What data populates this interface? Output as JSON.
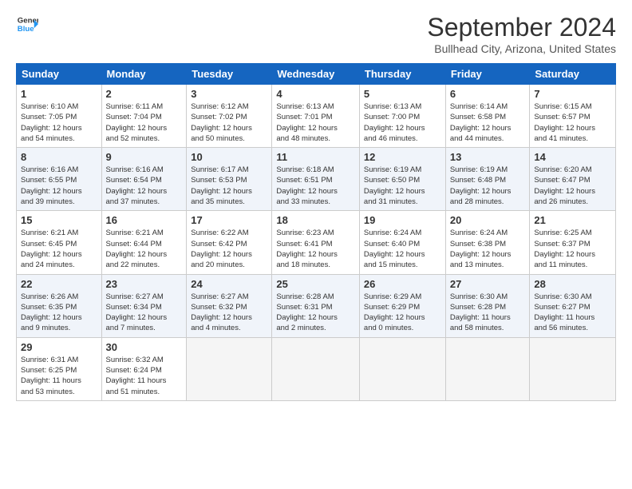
{
  "header": {
    "logo_line1": "General",
    "logo_line2": "Blue",
    "month_title": "September 2024",
    "location": "Bullhead City, Arizona, United States"
  },
  "weekdays": [
    "Sunday",
    "Monday",
    "Tuesday",
    "Wednesday",
    "Thursday",
    "Friday",
    "Saturday"
  ],
  "weeks": [
    [
      {
        "day": "1",
        "info": "Sunrise: 6:10 AM\nSunset: 7:05 PM\nDaylight: 12 hours\nand 54 minutes."
      },
      {
        "day": "2",
        "info": "Sunrise: 6:11 AM\nSunset: 7:04 PM\nDaylight: 12 hours\nand 52 minutes."
      },
      {
        "day": "3",
        "info": "Sunrise: 6:12 AM\nSunset: 7:02 PM\nDaylight: 12 hours\nand 50 minutes."
      },
      {
        "day": "4",
        "info": "Sunrise: 6:13 AM\nSunset: 7:01 PM\nDaylight: 12 hours\nand 48 minutes."
      },
      {
        "day": "5",
        "info": "Sunrise: 6:13 AM\nSunset: 7:00 PM\nDaylight: 12 hours\nand 46 minutes."
      },
      {
        "day": "6",
        "info": "Sunrise: 6:14 AM\nSunset: 6:58 PM\nDaylight: 12 hours\nand 44 minutes."
      },
      {
        "day": "7",
        "info": "Sunrise: 6:15 AM\nSunset: 6:57 PM\nDaylight: 12 hours\nand 41 minutes."
      }
    ],
    [
      {
        "day": "8",
        "info": "Sunrise: 6:16 AM\nSunset: 6:55 PM\nDaylight: 12 hours\nand 39 minutes."
      },
      {
        "day": "9",
        "info": "Sunrise: 6:16 AM\nSunset: 6:54 PM\nDaylight: 12 hours\nand 37 minutes."
      },
      {
        "day": "10",
        "info": "Sunrise: 6:17 AM\nSunset: 6:53 PM\nDaylight: 12 hours\nand 35 minutes."
      },
      {
        "day": "11",
        "info": "Sunrise: 6:18 AM\nSunset: 6:51 PM\nDaylight: 12 hours\nand 33 minutes."
      },
      {
        "day": "12",
        "info": "Sunrise: 6:19 AM\nSunset: 6:50 PM\nDaylight: 12 hours\nand 31 minutes."
      },
      {
        "day": "13",
        "info": "Sunrise: 6:19 AM\nSunset: 6:48 PM\nDaylight: 12 hours\nand 28 minutes."
      },
      {
        "day": "14",
        "info": "Sunrise: 6:20 AM\nSunset: 6:47 PM\nDaylight: 12 hours\nand 26 minutes."
      }
    ],
    [
      {
        "day": "15",
        "info": "Sunrise: 6:21 AM\nSunset: 6:45 PM\nDaylight: 12 hours\nand 24 minutes."
      },
      {
        "day": "16",
        "info": "Sunrise: 6:21 AM\nSunset: 6:44 PM\nDaylight: 12 hours\nand 22 minutes."
      },
      {
        "day": "17",
        "info": "Sunrise: 6:22 AM\nSunset: 6:42 PM\nDaylight: 12 hours\nand 20 minutes."
      },
      {
        "day": "18",
        "info": "Sunrise: 6:23 AM\nSunset: 6:41 PM\nDaylight: 12 hours\nand 18 minutes."
      },
      {
        "day": "19",
        "info": "Sunrise: 6:24 AM\nSunset: 6:40 PM\nDaylight: 12 hours\nand 15 minutes."
      },
      {
        "day": "20",
        "info": "Sunrise: 6:24 AM\nSunset: 6:38 PM\nDaylight: 12 hours\nand 13 minutes."
      },
      {
        "day": "21",
        "info": "Sunrise: 6:25 AM\nSunset: 6:37 PM\nDaylight: 12 hours\nand 11 minutes."
      }
    ],
    [
      {
        "day": "22",
        "info": "Sunrise: 6:26 AM\nSunset: 6:35 PM\nDaylight: 12 hours\nand 9 minutes."
      },
      {
        "day": "23",
        "info": "Sunrise: 6:27 AM\nSunset: 6:34 PM\nDaylight: 12 hours\nand 7 minutes."
      },
      {
        "day": "24",
        "info": "Sunrise: 6:27 AM\nSunset: 6:32 PM\nDaylight: 12 hours\nand 4 minutes."
      },
      {
        "day": "25",
        "info": "Sunrise: 6:28 AM\nSunset: 6:31 PM\nDaylight: 12 hours\nand 2 minutes."
      },
      {
        "day": "26",
        "info": "Sunrise: 6:29 AM\nSunset: 6:29 PM\nDaylight: 12 hours\nand 0 minutes."
      },
      {
        "day": "27",
        "info": "Sunrise: 6:30 AM\nSunset: 6:28 PM\nDaylight: 11 hours\nand 58 minutes."
      },
      {
        "day": "28",
        "info": "Sunrise: 6:30 AM\nSunset: 6:27 PM\nDaylight: 11 hours\nand 56 minutes."
      }
    ],
    [
      {
        "day": "29",
        "info": "Sunrise: 6:31 AM\nSunset: 6:25 PM\nDaylight: 11 hours\nand 53 minutes."
      },
      {
        "day": "30",
        "info": "Sunrise: 6:32 AM\nSunset: 6:24 PM\nDaylight: 11 hours\nand 51 minutes."
      },
      {
        "day": "",
        "info": ""
      },
      {
        "day": "",
        "info": ""
      },
      {
        "day": "",
        "info": ""
      },
      {
        "day": "",
        "info": ""
      },
      {
        "day": "",
        "info": ""
      }
    ]
  ]
}
